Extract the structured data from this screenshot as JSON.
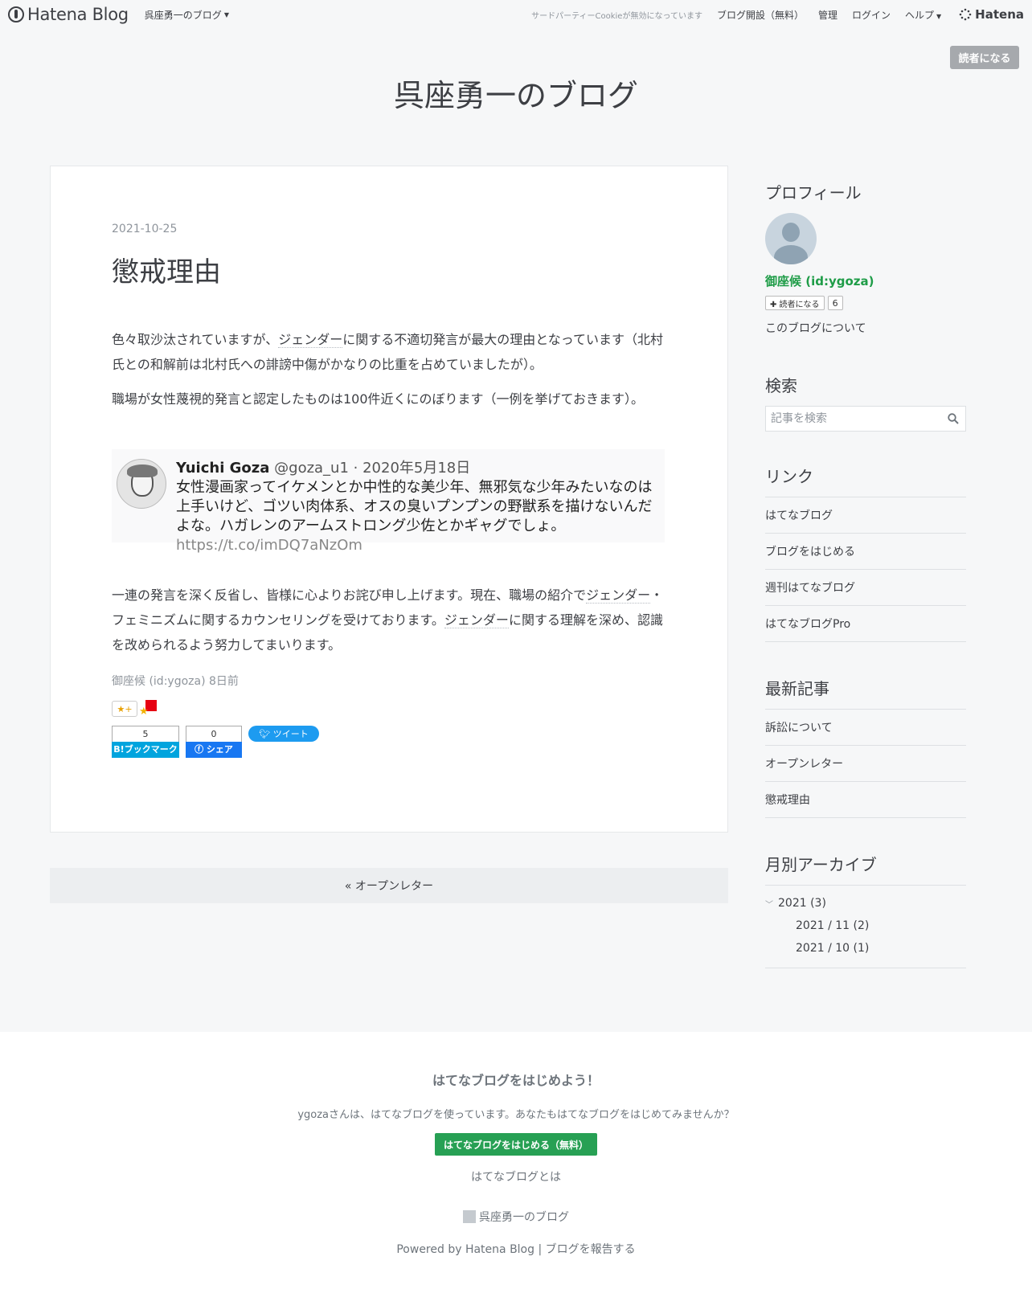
{
  "header": {
    "logo_text": "Hatena Blog",
    "blog_name": "呉座勇一のブログ",
    "cookie_notice": "サードパーティーCookieが無効になっています",
    "open_blog": "ブログ開設（無料）",
    "admin": "管理",
    "login": "ログイン",
    "help": "ヘルプ",
    "hatena": "Hatena"
  },
  "subscribe_label": "読者になる",
  "blog_title": "呉座勇一のブログ",
  "entry": {
    "date": "2021-10-25",
    "title": "懲戒理由",
    "p1_a": "色々取沙汰されていますが、",
    "p1_kw": "ジェンダー",
    "p1_b": "に関する不適切発言が最大の理由となっています（北村氏との和解前は北村氏への誹謗中傷がかなりの比重を占めていましたが）。",
    "p2": "職場が女性蔑視的発言と認定したものは100件近くにのぼります（一例を挙げておきます）。",
    "tweet": {
      "name": "Yuichi Goza",
      "meta": "@goza_u1 · 2020年5月18日",
      "text": "女性漫画家ってイケメンとか中性的な美少年、無邪気な少年みたいなのは上手いけど、ゴツい肉体系、オスの臭いプンプンの野獣系を描けないんだよな。ハガレンのアームストロング少佐とかギャグでしょ。",
      "url": "https://t.co/imDQ7aNzOm"
    },
    "p3_a": "一連の発言を深く反省し、皆様に心よりお詫び申し上げます。現在、職場の紹介で",
    "p3_kw1": "ジェンダー",
    "p3_b": "・フェミニズムに関するカウンセリングを受けております。",
    "p3_kw2": "ジェンダー",
    "p3_c": "に関する理解を深め、認識を改められるよう努力してまいります。",
    "author": "御座候 (id:ygoza)",
    "ago": "8日前",
    "star_add": "★+",
    "hatebu_count": "5",
    "hatebu_label": "B!ブックマーク",
    "fb_count": "0",
    "fb_label": "シェア",
    "tweet_label": "ツイート"
  },
  "pager_prev": "« オープンレター",
  "sidebar": {
    "profile_title": "プロフィール",
    "profile_name": "御座候 (id:ygoza)",
    "reader_label": "✚ 読者になる",
    "reader_count": "6",
    "about": "このブログについて",
    "search_title": "検索",
    "search_placeholder": "記事を検索",
    "links_title": "リンク",
    "links": [
      "はてなブログ",
      "ブログをはじめる",
      "週刊はてなブログ",
      "はてなブログPro"
    ],
    "recent_title": "最新記事",
    "recent": [
      "訴訟について",
      "オープンレター",
      "懲戒理由"
    ],
    "archive_title": "月別アーカイブ",
    "archive_year": "2021 (3)",
    "archive_months": [
      "2021 / 11 (2)",
      "2021 / 10 (1)"
    ]
  },
  "footer": {
    "title": "はてなブログをはじめよう！",
    "desc": "ygozaさんは、はてなブログを使っています。あなたもはてなブログをはじめてみませんか？",
    "start_button": "はてなブログをはじめる（無料）",
    "about": "はてなブログとは",
    "blog_name": "呉座勇一のブログ",
    "powered": "Powered by Hatena Blog",
    "separator": "|",
    "report": "ブログを報告する"
  },
  "colors": {
    "accent_green": "#27a054",
    "profile_green": "#1e9c47",
    "hatebu_blue": "#00a4de",
    "facebook_blue": "#1877f2",
    "twitter_blue": "#1d9bf0"
  }
}
